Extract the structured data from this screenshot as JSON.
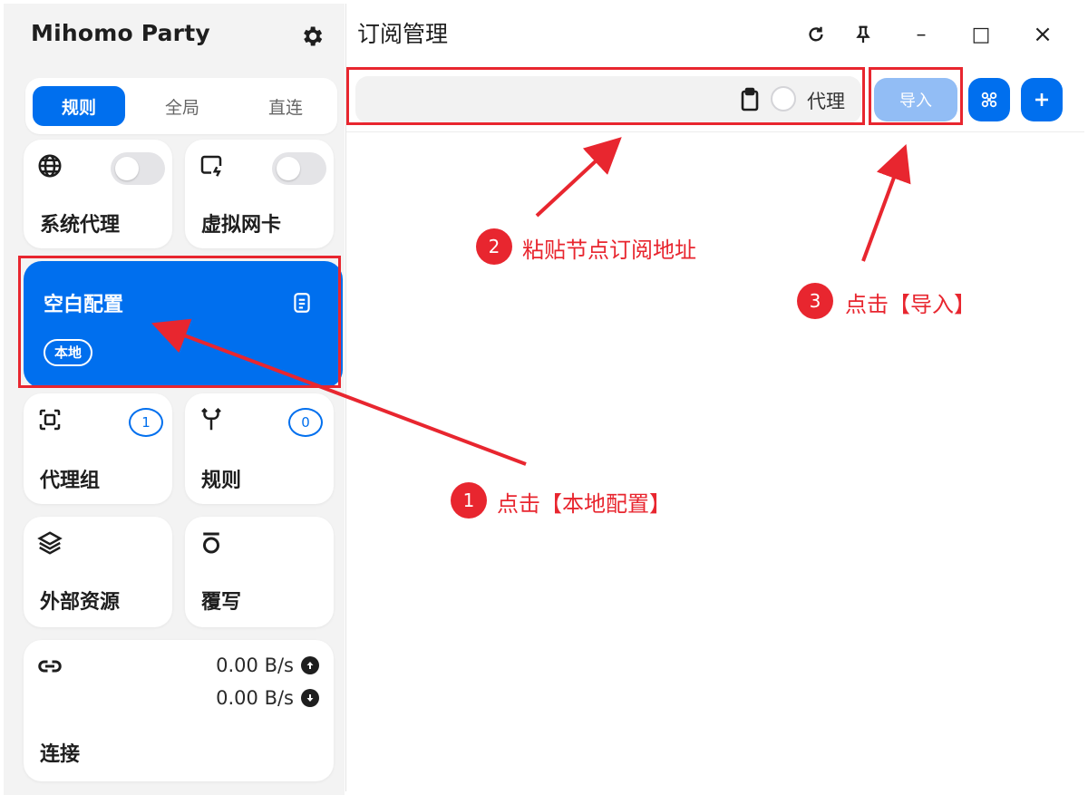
{
  "app": {
    "title": "Mihomo Party"
  },
  "icons": {
    "settings": "gear-icon",
    "system_proxy": "globe-icon",
    "tun": "virtual-nic-icon",
    "profile_doc": "document-icon",
    "proxy_groups": "proxy-group-icon",
    "rules": "fork-icon",
    "resources": "layers-icon",
    "override": "override-icon",
    "connections": "link-icon",
    "clipboard": "clipboard-icon",
    "qr": "qr-scan-icon",
    "add": "plus-icon"
  },
  "mode_tabs": [
    {
      "label": "规则",
      "active": true
    },
    {
      "label": "全局",
      "active": false
    },
    {
      "label": "直连",
      "active": false
    }
  ],
  "cards": {
    "system_proxy": {
      "label": "系统代理",
      "enabled": false
    },
    "tun": {
      "label": "虚拟网卡",
      "enabled": false
    },
    "profile": {
      "name": "空白配置",
      "tag": "本地"
    },
    "proxy_groups": {
      "label": "代理组",
      "count": "1"
    },
    "rules": {
      "label": "规则",
      "count": "0"
    },
    "resources": {
      "label": "外部资源"
    },
    "override": {
      "label": "覆写"
    },
    "connections": {
      "label": "连接",
      "upload": "0.00 B/s",
      "download": "0.00 B/s"
    }
  },
  "main": {
    "title": "订阅管理",
    "url_input": {
      "value": "",
      "placeholder": ""
    },
    "proxy_label": "代理",
    "import_label": "导入"
  },
  "window_controls": {
    "minimize": "–",
    "maximize": "□",
    "close": "×"
  },
  "annotations": [
    {
      "step": "1",
      "text": "点击【本地配置】"
    },
    {
      "step": "2",
      "text": "粘贴节点订阅地址"
    },
    {
      "step": "3",
      "text": "点击【导入】"
    }
  ],
  "colors": {
    "accent": "#006fee",
    "annotation": "#e8262f",
    "import_disabled": "#92bdf5"
  }
}
